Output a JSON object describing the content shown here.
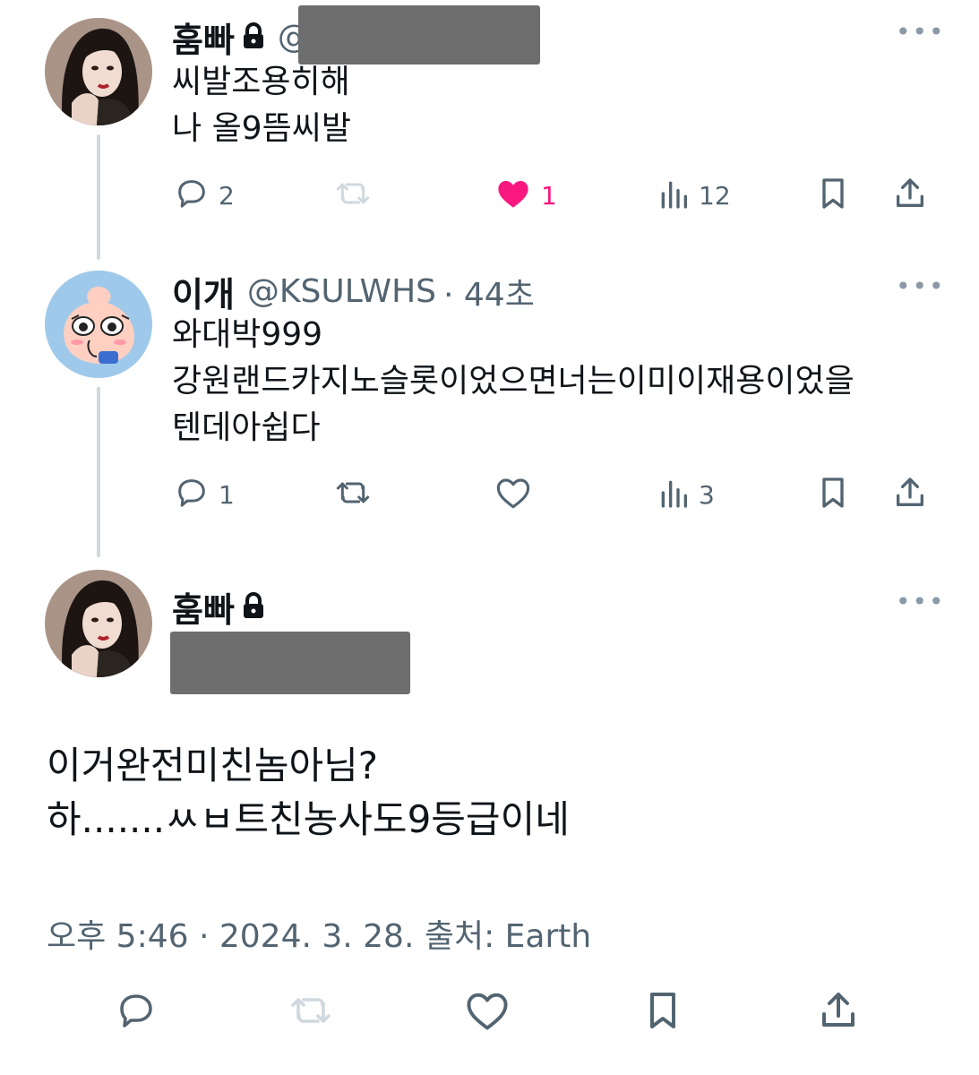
{
  "tweets": [
    {
      "name": "훔빠",
      "handle": "@",
      "lines": [
        "씨발조용히해",
        "나 올9뜸씨발"
      ],
      "actions": {
        "reply_count": "2",
        "like_count": "1",
        "views_count": "12"
      }
    },
    {
      "name": "이개",
      "handle": "@KSULWHS",
      "time": "· 44초",
      "lines": [
        "와대박999",
        "강원랜드카지노슬롯이었으면너는이미이재용이었을",
        "텐데아쉽다"
      ],
      "actions": {
        "reply_count": "1",
        "views_count": "3"
      }
    }
  ],
  "main_tweet": {
    "name": "훔빠",
    "lines": [
      "이거완전미친놈아님?",
      "하.......ㅆㅂ트친농사도9등급이네"
    ],
    "meta": "오후 5:46 · 2024. 3. 28. 출처: Earth"
  },
  "colors": {
    "like_active": "#f91880",
    "icon_gray": "#536471",
    "retweet_disabled": "#cfd9de",
    "thread_line": "#cfd9de"
  },
  "icons": [
    "reply-icon",
    "retweet-icon",
    "like-icon",
    "views-icon",
    "bookmark-icon",
    "share-icon",
    "lock-icon",
    "more-icon"
  ]
}
